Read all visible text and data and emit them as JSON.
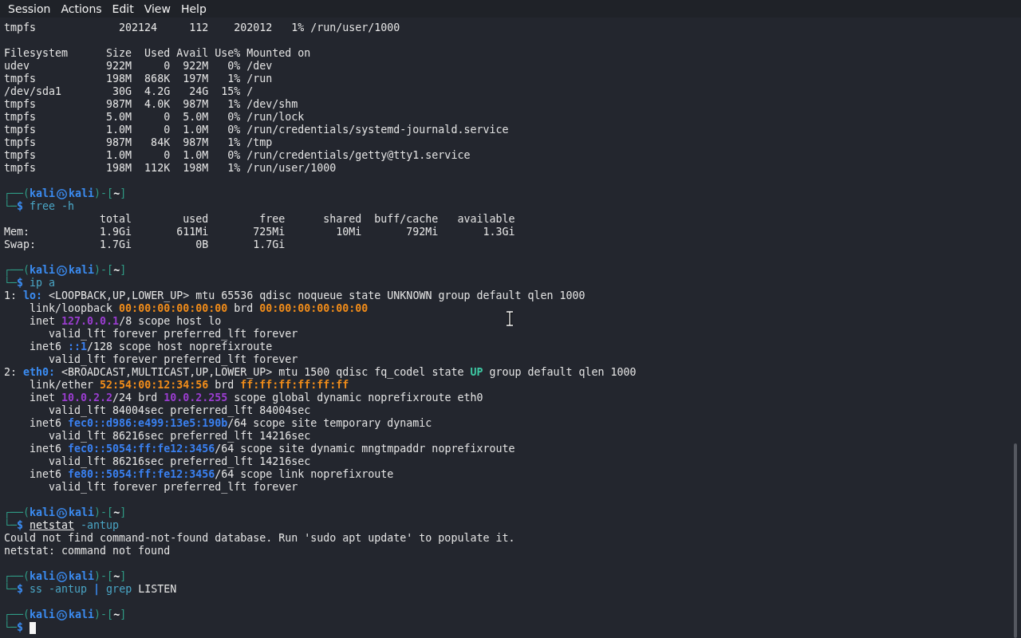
{
  "menu": [
    "Session",
    "Actions",
    "Edit",
    "View",
    "Help"
  ],
  "blocks": [
    {
      "lines": [
        {
          "text": "tmpfs             202124     112    202012   1% /run/user/1000"
        }
      ]
    },
    {
      "lines": [
        {
          "text": "Filesystem      Size  Used Avail Use% Mounted on"
        },
        {
          "text": "udev            922M     0  922M   0% /dev"
        },
        {
          "text": "tmpfs           198M  868K  197M   1% /run"
        },
        {
          "text": "/dev/sda1        30G  4.2G   24G  15% /"
        },
        {
          "text": "tmpfs           987M  4.0K  987M   1% /dev/shm"
        },
        {
          "text": "tmpfs           5.0M     0  5.0M   0% /run/lock"
        },
        {
          "text": "tmpfs           1.0M     0  1.0M   0% /run/credentials/systemd-journald.service"
        },
        {
          "text": "tmpfs           987M   84K  987M   1% /tmp"
        },
        {
          "text": "tmpfs           1.0M     0  1.0M   0% /run/credentials/getty@tty1.service"
        },
        {
          "text": "tmpfs           198M  112K  198M   1% /run/user/1000"
        }
      ]
    },
    {
      "lines": [
        {
          "segments": [
            {
              "kind": "frame",
              "text": "┌──("
            },
            {
              "kind": "user",
              "text": "kali"
            },
            {
              "kind": "symbol"
            },
            {
              "kind": "user",
              "text": "kali"
            },
            {
              "kind": "frame",
              "text": ")-["
            },
            {
              "kind": "path",
              "text": "~"
            },
            {
              "kind": "frame",
              "text": "]"
            }
          ]
        },
        {
          "segments": [
            {
              "kind": "frame",
              "text": "└─"
            },
            {
              "kind": "prompt",
              "text": "$"
            },
            {
              "kind": "cmd",
              "text": " free -h"
            }
          ]
        },
        {
          "text": "               total        used        free      shared  buff/cache   available"
        },
        {
          "text": "Mem:           1.9Gi       611Mi       725Mi        10Mi       792Mi       1.3Gi"
        },
        {
          "text": "Swap:          1.7Gi          0B       1.7Gi"
        }
      ]
    },
    {
      "lines": [
        {
          "segments": [
            {
              "kind": "frame",
              "text": "┌──("
            },
            {
              "kind": "user",
              "text": "kali"
            },
            {
              "kind": "symbol"
            },
            {
              "kind": "user",
              "text": "kali"
            },
            {
              "kind": "frame",
              "text": ")-["
            },
            {
              "kind": "path",
              "text": "~"
            },
            {
              "kind": "frame",
              "text": "]"
            }
          ]
        },
        {
          "segments": [
            {
              "kind": "frame",
              "text": "└─"
            },
            {
              "kind": "prompt",
              "text": "$"
            },
            {
              "kind": "cmd",
              "text": " ip a"
            }
          ]
        },
        {
          "segments": [
            {
              "kind": "plain",
              "text": "1: "
            },
            {
              "kind": "iface",
              "text": "lo:"
            },
            {
              "kind": "plain",
              "text": " <LOOPBACK,UP,LOWER_UP> mtu 65536 qdisc noqueue state UNKNOWN group default qlen 1000"
            }
          ]
        },
        {
          "segments": [
            {
              "kind": "plain",
              "text": "    link/loopback "
            },
            {
              "kind": "mac",
              "text": "00:00:00:00:00:00"
            },
            {
              "kind": "plain",
              "text": " brd "
            },
            {
              "kind": "mac",
              "text": "00:00:00:00:00:00"
            }
          ]
        },
        {
          "segments": [
            {
              "kind": "plain",
              "text": "    inet "
            },
            {
              "kind": "ipv4",
              "text": "127.0.0.1"
            },
            {
              "kind": "plain",
              "text": "/8 scope host lo"
            }
          ]
        },
        {
          "text": "       valid_lft forever preferred_lft forever"
        },
        {
          "segments": [
            {
              "kind": "plain",
              "text": "    inet6 "
            },
            {
              "kind": "ipv6",
              "text": "::1"
            },
            {
              "kind": "plain",
              "text": "/128 scope host noprefixroute"
            }
          ]
        },
        {
          "text": "       valid_lft forever preferred_lft forever"
        },
        {
          "segments": [
            {
              "kind": "plain",
              "text": "2: "
            },
            {
              "kind": "iface",
              "text": "eth0:"
            },
            {
              "kind": "plain",
              "text": " <BROADCAST,MULTICAST,UP,LOWER_UP> mtu 1500 qdisc fq_codel state "
            },
            {
              "kind": "up",
              "text": "UP"
            },
            {
              "kind": "plain",
              "text": " group default qlen 1000"
            }
          ]
        },
        {
          "segments": [
            {
              "kind": "plain",
              "text": "    link/ether "
            },
            {
              "kind": "mac",
              "text": "52:54:00:12:34:56"
            },
            {
              "kind": "plain",
              "text": " brd "
            },
            {
              "kind": "mac",
              "text": "ff:ff:ff:ff:ff:ff"
            }
          ]
        },
        {
          "segments": [
            {
              "kind": "plain",
              "text": "    inet "
            },
            {
              "kind": "ipv4",
              "text": "10.0.2.2"
            },
            {
              "kind": "plain",
              "text": "/24 brd "
            },
            {
              "kind": "ipv4",
              "text": "10.0.2.255"
            },
            {
              "kind": "plain",
              "text": " scope global dynamic noprefixroute eth0"
            }
          ]
        },
        {
          "text": "       valid_lft 84004sec preferred_lft 84004sec"
        },
        {
          "segments": [
            {
              "kind": "plain",
              "text": "    inet6 "
            },
            {
              "kind": "ipv6",
              "text": "fec0::d986:e499:13e5:190b"
            },
            {
              "kind": "plain",
              "text": "/64 scope site temporary dynamic"
            }
          ]
        },
        {
          "text": "       valid_lft 86216sec preferred_lft 14216sec"
        },
        {
          "segments": [
            {
              "kind": "plain",
              "text": "    inet6 "
            },
            {
              "kind": "ipv6",
              "text": "fec0::5054:ff:fe12:3456"
            },
            {
              "kind": "plain",
              "text": "/64 scope site dynamic mngtmpaddr noprefixroute"
            }
          ]
        },
        {
          "text": "       valid_lft 86216sec preferred_lft 14216sec"
        },
        {
          "segments": [
            {
              "kind": "plain",
              "text": "    inet6 "
            },
            {
              "kind": "ipv6",
              "text": "fe80::5054:ff:fe12:3456"
            },
            {
              "kind": "plain",
              "text": "/64 scope link noprefixroute"
            }
          ]
        },
        {
          "text": "       valid_lft forever preferred_lft forever"
        }
      ]
    },
    {
      "lines": [
        {
          "segments": [
            {
              "kind": "frame",
              "text": "┌──("
            },
            {
              "kind": "user",
              "text": "kali"
            },
            {
              "kind": "symbol"
            },
            {
              "kind": "user",
              "text": "kali"
            },
            {
              "kind": "frame",
              "text": ")-["
            },
            {
              "kind": "path",
              "text": "~"
            },
            {
              "kind": "frame",
              "text": "]"
            }
          ]
        },
        {
          "segments": [
            {
              "kind": "frame",
              "text": "└─"
            },
            {
              "kind": "prompt",
              "text": "$ "
            },
            {
              "kind": "unknown",
              "text": "netstat"
            },
            {
              "kind": "cmd",
              "text": " -antup"
            }
          ]
        },
        {
          "text": "Could not find command-not-found database. Run 'sudo apt update' to populate it."
        },
        {
          "text": "netstat: command not found"
        }
      ]
    },
    {
      "lines": [
        {
          "segments": [
            {
              "kind": "frame",
              "text": "┌──("
            },
            {
              "kind": "user",
              "text": "kali"
            },
            {
              "kind": "symbol"
            },
            {
              "kind": "user",
              "text": "kali"
            },
            {
              "kind": "frame",
              "text": ")-["
            },
            {
              "kind": "path",
              "text": "~"
            },
            {
              "kind": "frame",
              "text": "]"
            }
          ]
        },
        {
          "segments": [
            {
              "kind": "frame",
              "text": "└─"
            },
            {
              "kind": "prompt",
              "text": "$"
            },
            {
              "kind": "cmd",
              "text": " ss -antup "
            },
            {
              "kind": "pipe",
              "text": "|"
            },
            {
              "kind": "cmd",
              "text": " grep "
            },
            {
              "kind": "plain",
              "text": "LISTEN"
            }
          ]
        }
      ]
    },
    {
      "lines": [
        {
          "segments": [
            {
              "kind": "frame",
              "text": "┌──("
            },
            {
              "kind": "user",
              "text": "kali"
            },
            {
              "kind": "symbol"
            },
            {
              "kind": "user",
              "text": "kali"
            },
            {
              "kind": "frame",
              "text": ")-["
            },
            {
              "kind": "path",
              "text": "~"
            },
            {
              "kind": "frame",
              "text": "]"
            }
          ]
        },
        {
          "cursor": true,
          "segments": [
            {
              "kind": "frame",
              "text": "└─"
            },
            {
              "kind": "prompt",
              "text": "$"
            }
          ]
        }
      ]
    }
  ]
}
